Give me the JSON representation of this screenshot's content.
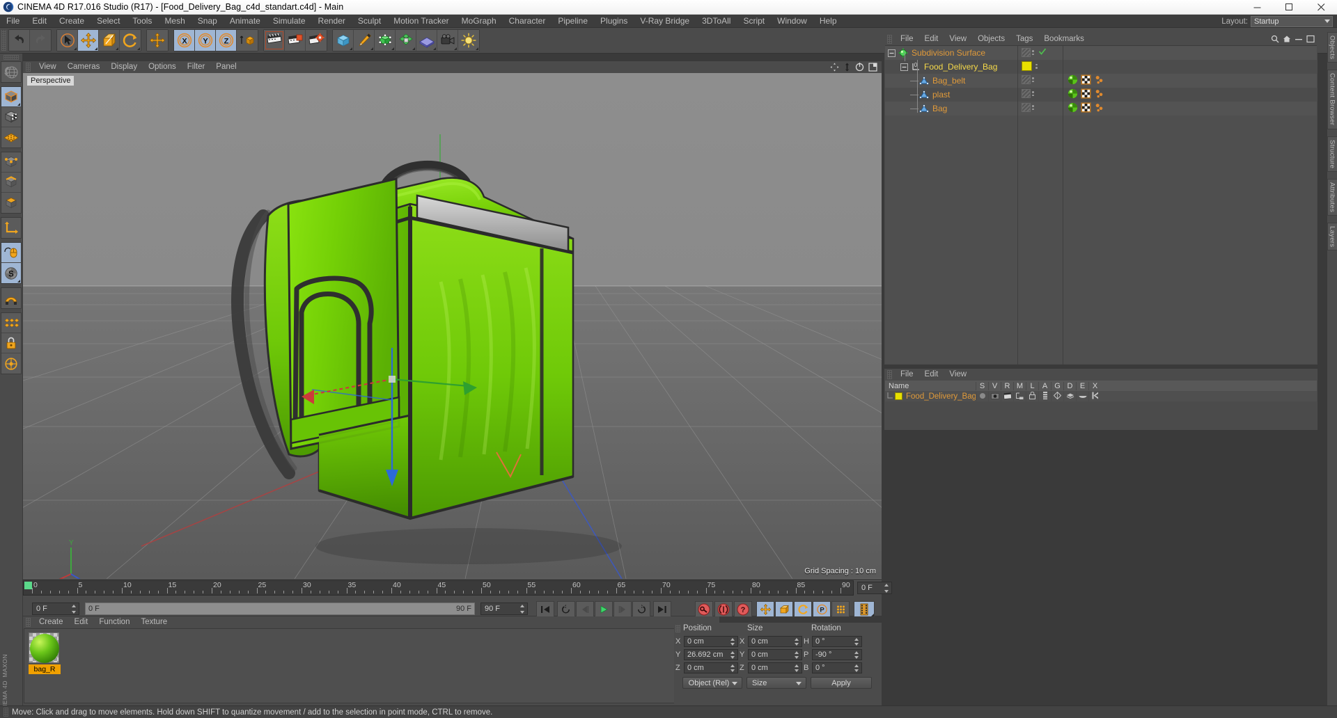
{
  "window": {
    "title": "CINEMA 4D R17.016 Studio (R17) - [Food_Delivery_Bag_c4d_standart.c4d] - Main",
    "app_icon": "cinema4d-logo-icon",
    "minimize": "─",
    "maximize": "❐",
    "close": "✕"
  },
  "menubar": {
    "items": [
      "File",
      "Edit",
      "Create",
      "Select",
      "Tools",
      "Mesh",
      "Snap",
      "Animate",
      "Simulate",
      "Render",
      "Sculpt",
      "Motion Tracker",
      "MoGraph",
      "Character",
      "Pipeline",
      "Plugins",
      "V-Ray Bridge",
      "3DToAll",
      "Script",
      "Window",
      "Help"
    ],
    "layout_label": "Layout:",
    "layout_value": "Startup"
  },
  "toolbar": {
    "groups": [
      {
        "buttons": [
          {
            "name": "undo-button",
            "icon": "undo-arrow-icon",
            "state": "normal"
          },
          {
            "name": "redo-button",
            "icon": "redo-arrow-icon",
            "state": "disabled"
          }
        ]
      },
      {
        "buttons": [
          {
            "name": "live-selection-tool",
            "icon": "cursor-circle-icon",
            "state": "normal"
          },
          {
            "name": "move-tool",
            "icon": "move-cross-icon",
            "state": "active"
          },
          {
            "name": "scale-tool",
            "icon": "scale-box-icon",
            "state": "normal"
          },
          {
            "name": "rotate-tool",
            "icon": "rotate-circle-icon",
            "state": "normal"
          }
        ]
      },
      {
        "buttons": [
          {
            "name": "move-duplicate-tool",
            "icon": "move-cross-icon",
            "state": "normal"
          }
        ]
      },
      {
        "buttons": [
          {
            "name": "lock-x-axis",
            "icon": "axis-x-icon",
            "state": "active"
          },
          {
            "name": "lock-y-axis",
            "icon": "axis-y-icon",
            "state": "active"
          },
          {
            "name": "lock-z-axis",
            "icon": "axis-z-icon",
            "state": "active"
          },
          {
            "name": "world-object-coordinates",
            "icon": "world-cube-icon",
            "state": "normal"
          }
        ]
      },
      {
        "buttons": [
          {
            "name": "render-view",
            "icon": "render-clapper-icon",
            "state": "normal"
          },
          {
            "name": "render-to-picture-viewer",
            "icon": "render-picture-icon",
            "state": "normal"
          },
          {
            "name": "render-settings",
            "icon": "render-gear-icon",
            "state": "normal"
          }
        ]
      },
      {
        "buttons": [
          {
            "name": "add-cube-object",
            "icon": "blue-cube-icon",
            "state": "normal"
          },
          {
            "name": "add-spline-object",
            "icon": "pen-nib-icon",
            "state": "normal"
          },
          {
            "name": "add-generator-object",
            "icon": "green-cube-icon",
            "state": "normal"
          },
          {
            "name": "add-deformer-object",
            "icon": "green-deformer-icon",
            "state": "normal"
          },
          {
            "name": "add-environment-object",
            "icon": "floor-plane-icon",
            "state": "normal"
          },
          {
            "name": "add-camera-object",
            "icon": "camera-icon",
            "state": "normal"
          },
          {
            "name": "add-light-object",
            "icon": "light-bulb-icon",
            "state": "normal"
          }
        ]
      }
    ]
  },
  "left_toolbar": {
    "buttons": [
      {
        "name": "undo-view-button",
        "icon": "globe-undo-icon",
        "state": "disabled"
      },
      {
        "name": "model-mode-button",
        "icon": "model-cube-icon",
        "state": "active"
      },
      {
        "name": "texture-mode-button",
        "icon": "texture-checker-cube-icon",
        "state": "normal"
      },
      {
        "name": "polygon-grid-button",
        "icon": "polygon-grid-icon",
        "state": "normal"
      },
      {
        "name": "points-mode-button",
        "icon": "points-cube-icon",
        "state": "normal"
      },
      {
        "name": "edges-mode-button",
        "icon": "edges-cube-icon",
        "state": "normal"
      },
      {
        "name": "polygons-mode-button",
        "icon": "polygons-cube-icon",
        "state": "normal"
      },
      {
        "name": "object-axis-button",
        "icon": "axis-corner-icon",
        "state": "normal"
      },
      {
        "name": "enable-snap-button",
        "icon": "mouse-snap-icon",
        "state": "active"
      },
      {
        "name": "smooth-shift-button",
        "icon": "s-circle-icon",
        "state": "active"
      },
      {
        "name": "workplane-button",
        "icon": "magnet-icon",
        "state": "normal"
      },
      {
        "name": "viewport-solo-button",
        "icon": "grid-diamond-icon",
        "state": "normal"
      },
      {
        "name": "lock-selection-button",
        "icon": "lock-icon",
        "state": "normal"
      },
      {
        "name": "quantize-button",
        "icon": "quantize-icon",
        "state": "normal"
      }
    ]
  },
  "viewport": {
    "menu": [
      "View",
      "Cameras",
      "Display",
      "Options",
      "Filter",
      "Panel"
    ],
    "label": "Perspective",
    "grid_spacing": "Grid Spacing : 10 cm",
    "icons": [
      "viewport-move-icon",
      "viewport-pan-icon",
      "viewport-rotate-icon",
      "viewport-maximize-icon"
    ],
    "object_color": "#7ad406",
    "trim_color": "#2b2b2b",
    "strip_color": "#b9b9b9"
  },
  "timeline": {
    "ruler_labels": [
      "0",
      "5",
      "10",
      "15",
      "20",
      "25",
      "30",
      "35",
      "40",
      "45",
      "50",
      "55",
      "60",
      "65",
      "70",
      "75",
      "80",
      "85",
      "90"
    ],
    "current_frame_right": "0 F",
    "current_frame_field": "0 F",
    "scroll_start": "0 F",
    "scroll_end": "90 F",
    "max_frame_field": "90 F",
    "playhead_frame": 0,
    "transport": [
      {
        "name": "go-to-start-button",
        "icon": "skip-start-icon"
      },
      {
        "name": "play-reverse-loop-button",
        "icon": "loop-back-icon"
      },
      {
        "name": "step-back-button",
        "icon": "step-back-icon"
      },
      {
        "name": "play-button",
        "icon": "play-icon"
      },
      {
        "name": "step-forward-button",
        "icon": "step-forward-icon"
      },
      {
        "name": "play-forward-loop-button",
        "icon": "loop-forward-icon"
      },
      {
        "name": "go-to-end-button",
        "icon": "skip-end-icon"
      }
    ],
    "keyframe_buttons": [
      {
        "name": "record-active-objects-button",
        "icon": "record-key-icon"
      },
      {
        "name": "autokeying-button",
        "icon": "autokey-icon"
      },
      {
        "name": "keyframe-selection-button",
        "icon": "key-question-icon"
      }
    ],
    "key_toggle_buttons": [
      {
        "name": "record-position-button",
        "icon": "position-cross-icon",
        "state": "active"
      },
      {
        "name": "record-scale-button",
        "icon": "scale-box-icon",
        "state": "active"
      },
      {
        "name": "record-rotation-button",
        "icon": "rotate-circle-icon",
        "state": "active"
      },
      {
        "name": "record-pla-button",
        "icon": "pla-p-icon",
        "state": "active"
      },
      {
        "name": "record-parameter-button",
        "icon": "param-dots-icon",
        "state": "normal"
      },
      {
        "name": "timeline-filmstrip-button",
        "icon": "filmstrip-icon",
        "state": "active"
      }
    ]
  },
  "material_manager": {
    "menu": [
      "Create",
      "Edit",
      "Function",
      "Texture"
    ],
    "materials": [
      {
        "name": "bag_R",
        "selected": true,
        "color": "#6bc61a"
      }
    ]
  },
  "coordinates": {
    "headers": [
      "Position",
      "Size",
      "Rotation"
    ],
    "rows": [
      {
        "pos_label": "X",
        "pos_value": "0 cm",
        "size_label": "X",
        "size_value": "0 cm",
        "rot_label": "H",
        "rot_value": "0 °"
      },
      {
        "pos_label": "Y",
        "pos_value": "26.692 cm",
        "size_label": "Y",
        "size_value": "0 cm",
        "rot_label": "P",
        "rot_value": "-90 °"
      },
      {
        "pos_label": "Z",
        "pos_value": "0 cm",
        "size_label": "Z",
        "size_value": "0 cm",
        "rot_label": "B",
        "rot_value": "0 °"
      }
    ],
    "mode_select": "Object (Rel)",
    "size_select": "Size",
    "apply_button": "Apply"
  },
  "object_manager": {
    "menu": [
      "File",
      "Edit",
      "View",
      "Objects",
      "Tags",
      "Bookmarks"
    ],
    "icons": [
      "search-icon",
      "home-icon",
      "minimize-icon",
      "maximize-icon"
    ],
    "items": [
      {
        "name": "Subdivision Surface",
        "indent": 0,
        "icon": "subdivision-surface-icon",
        "selected": false,
        "visible_dots": true,
        "check": true,
        "tags": []
      },
      {
        "name": "Food_Delivery_Bag",
        "indent": 1,
        "icon": "null-object-icon",
        "selected": true,
        "layer_color": "#e8e000",
        "visible_dots": true,
        "check": false,
        "tags": []
      },
      {
        "name": "Bag_belt",
        "indent": 2,
        "icon": "polygon-object-icon",
        "selected": false,
        "visible_dots": true,
        "check": false,
        "tags": [
          "material-tag",
          "uv-tag",
          "phong-tag"
        ]
      },
      {
        "name": "plast",
        "indent": 2,
        "icon": "polygon-object-icon",
        "selected": false,
        "visible_dots": true,
        "check": false,
        "tags": [
          "material-tag",
          "uv-tag",
          "phong-tag"
        ]
      },
      {
        "name": "Bag",
        "indent": 2,
        "icon": "polygon-object-icon",
        "selected": false,
        "visible_dots": true,
        "check": false,
        "tags": [
          "material-tag",
          "uv-tag",
          "phong-tag"
        ]
      }
    ]
  },
  "layer_manager": {
    "menu": [
      "File",
      "Edit",
      "View"
    ],
    "columns": [
      "Name",
      "S",
      "V",
      "R",
      "M",
      "L",
      "A",
      "G",
      "D",
      "E",
      "X"
    ],
    "rows": [
      {
        "name": "Food_Delivery_Bag",
        "color": "#e8e000"
      }
    ]
  },
  "right_tabs": [
    "Objects",
    "Content Browser",
    "Structure",
    "Attributes",
    "Layers"
  ],
  "statusbar": {
    "message": "Move: Click and drag to move elements. Hold down SHIFT to quantize movement / add to the selection in point mode, CTRL to remove."
  },
  "branding": {
    "maxon": "MAXON",
    "product": "CINEMA 4D"
  }
}
